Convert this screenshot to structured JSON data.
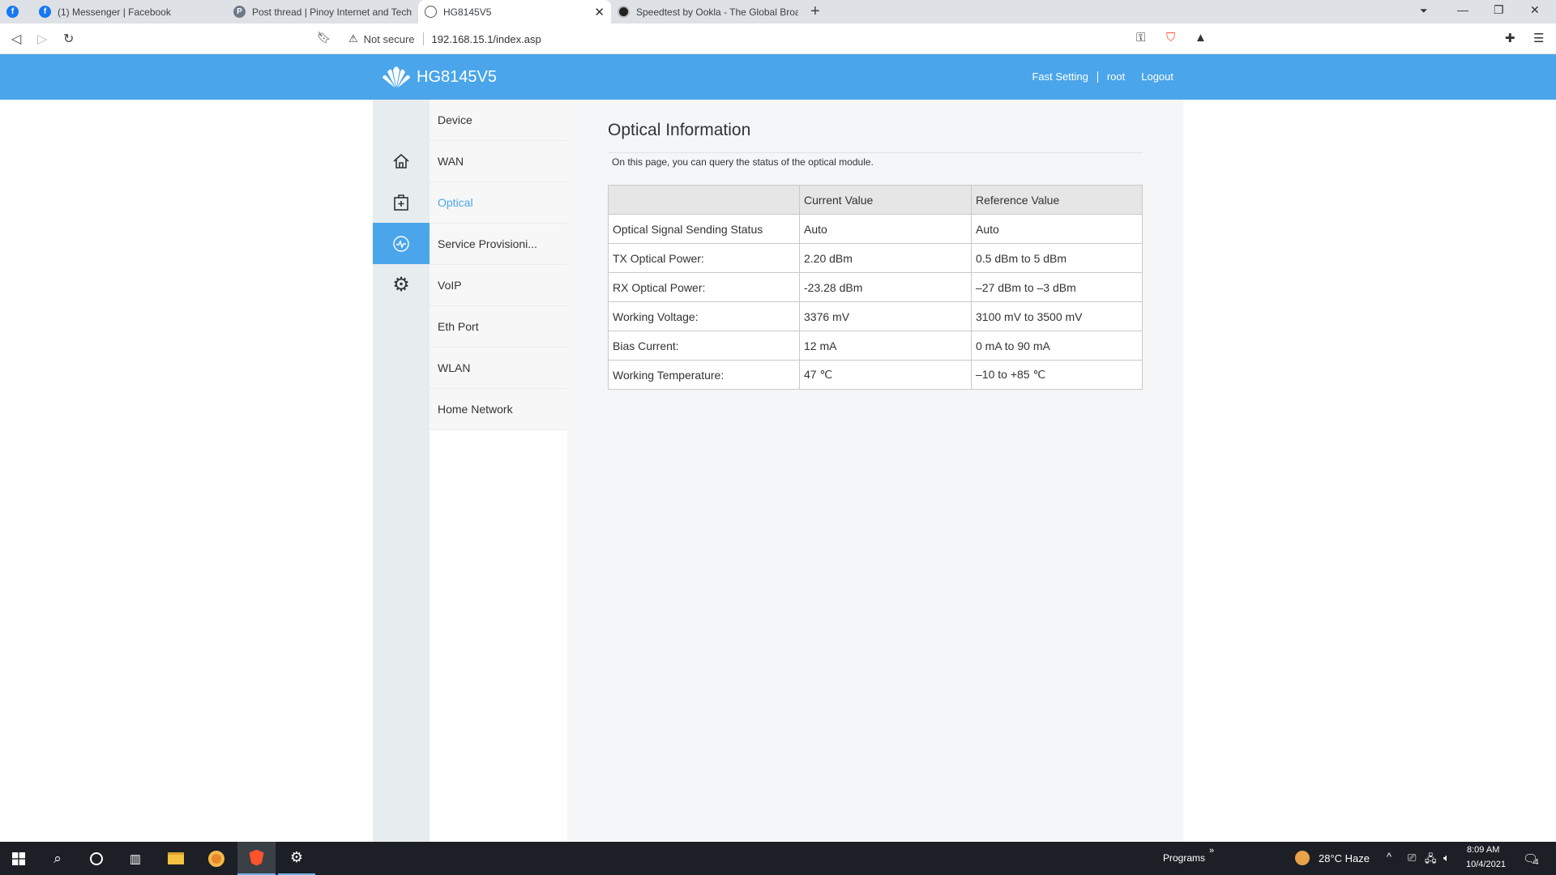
{
  "browser": {
    "tabs": [
      {
        "title": "(1) Messenger | Facebook",
        "icon": "facebook-icon"
      },
      {
        "title": "Post thread | Pinoy Internet and Tech",
        "icon": "pinoy-forum-icon"
      },
      {
        "title": "HG8145V5",
        "icon": "globe-icon"
      },
      {
        "title": "Speedtest by Ookla - The Global Broa",
        "icon": "speedtest-icon"
      }
    ],
    "security_label": "Not secure",
    "url": "192.168.15.1/index.asp"
  },
  "header": {
    "logo_text": "HG8145V5",
    "links": [
      "Fast Setting",
      "root",
      "Logout"
    ]
  },
  "sidebar": {
    "rail": [
      {
        "icon": "home-icon"
      },
      {
        "icon": "medical-kit-icon"
      },
      {
        "icon": "pulse-icon",
        "active": true
      },
      {
        "icon": "gear-icon"
      }
    ],
    "items": [
      "Device",
      "WAN",
      "Optical",
      "Service Provisioni...",
      "VoIP",
      "Eth Port",
      "WLAN",
      "Home Network"
    ],
    "current": "Optical"
  },
  "main": {
    "title": "Optical Information",
    "description": "On this page, you can query the status of the optical module.",
    "table": {
      "headers": [
        "",
        "Current Value",
        "Reference Value"
      ],
      "rows": [
        [
          "Optical Signal Sending Status",
          "Auto",
          "Auto"
        ],
        [
          "TX Optical Power:",
          "2.20 dBm",
          "0.5 dBm to 5 dBm"
        ],
        [
          "RX Optical Power:",
          "-23.28 dBm",
          "–27 dBm to –3 dBm"
        ],
        [
          "Working Voltage:",
          "3376 mV",
          "3100 mV to 3500 mV"
        ],
        [
          "Bias Current:",
          "12 mA",
          "0 mA to 90 mA"
        ],
        [
          "Working Temperature:",
          "47 ℃",
          "–10 to +85 ℃"
        ]
      ]
    }
  },
  "taskbar": {
    "programs_label": "Programs",
    "weather": "28°C  Haze",
    "time": "8:09 AM",
    "date": "10/4/2021",
    "notification_count": "4"
  },
  "colors": {
    "accent": "#4aa5ea",
    "rail_bg": "#e7ecee",
    "content_bg": "#f4f6f8",
    "taskbar_bg": "#1c2026"
  }
}
